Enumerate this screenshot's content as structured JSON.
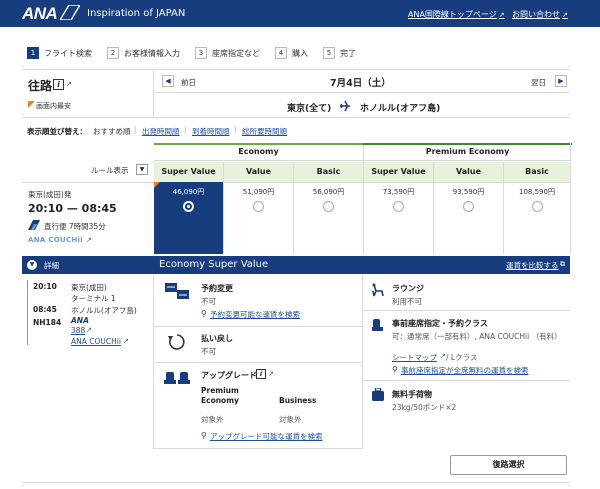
{
  "header": {
    "brand": "ANA",
    "tagline": "Inspiration of JAPAN",
    "link_top": "ANA国際線トップページ",
    "link_contact": "お問い合わせ"
  },
  "steps": [
    {
      "num": "1",
      "label": "フライト検索",
      "active": true
    },
    {
      "num": "2",
      "label": "お客様情報入力",
      "active": false
    },
    {
      "num": "3",
      "label": "座席指定など",
      "active": false
    },
    {
      "num": "4",
      "label": "購入",
      "active": false
    },
    {
      "num": "5",
      "label": "完了",
      "active": false
    }
  ],
  "outbound": {
    "title": "往路",
    "info": "i",
    "badge": "画面内最安"
  },
  "datebar": {
    "prev": "前日",
    "date": "7月4日（土）",
    "next": "翌日"
  },
  "route": {
    "from": "東京(全て)",
    "to": "ホノルル(オアフ島)"
  },
  "sort": {
    "label": "表示順並び替え：",
    "current": "おすすめ順",
    "options": [
      "出発時間順",
      "到着時間順",
      "総所要時間順"
    ]
  },
  "rule_label": "ルール表示",
  "cabins": [
    {
      "name": "Economy",
      "color": "#6aa843"
    },
    {
      "name": "Premium Economy",
      "color": "#3f8431"
    }
  ],
  "fare_columns": [
    "Super Value",
    "Value",
    "Basic",
    "Super Value",
    "Value",
    "Basic"
  ],
  "flight": {
    "origin": "東京(成田)発",
    "times": "20:10 — 08:45",
    "nonstop": "直行便 7時間35分",
    "codeshare_brand": "ANA COUCHii",
    "prices": [
      "46,090円",
      "51,090円",
      "56,090円",
      "73,590円",
      "93,590円",
      "108,590円"
    ],
    "selected_index": 0
  },
  "details": {
    "toggle_label": "詳細",
    "fare_title": "Economy Super Value",
    "compare_link": "運賃を比較する"
  },
  "itinerary": {
    "dep_time": "20:10",
    "dep_place": "東京(成田)",
    "dep_terminal": "ターミナル 1",
    "arr_time": "08:45",
    "arr_place": "ホノルル(オアフ島)",
    "flight_no": "NH184",
    "carrier_logo": "ANA",
    "aircraft": "388",
    "seat_brand": "ANA COUCHii"
  },
  "rules": {
    "change_title": "予約変更",
    "change_value": "不可",
    "change_link": "予約変更可能な運賃を検索",
    "refund_title": "払い戻し",
    "refund_value": "不可",
    "upgrade_title": "アップグレード",
    "upgrade_info": "i",
    "upgrade_col1": "Premium Economy",
    "upgrade_col2": "Business",
    "upgrade_val1": "対象外",
    "upgrade_val2": "対象外",
    "upgrade_link": "アップグレード可能な運賃を検索"
  },
  "services": {
    "lounge_title": "ラウンジ",
    "lounge_value": "利用不可",
    "seat_title": "事前座席指定・予約クラス",
    "seat_value": "可：通常席（一部有料）, ANA COUCHii （有料）",
    "seatmap_link": "シートマップ",
    "seat_class": " / Lクラス",
    "seat_link": "事前座席指定が全席無料の運賃を検索",
    "baggage_title": "無料手荷物",
    "baggage_value": "23kg/50ポンド×2"
  },
  "select_button": "復路選択"
}
